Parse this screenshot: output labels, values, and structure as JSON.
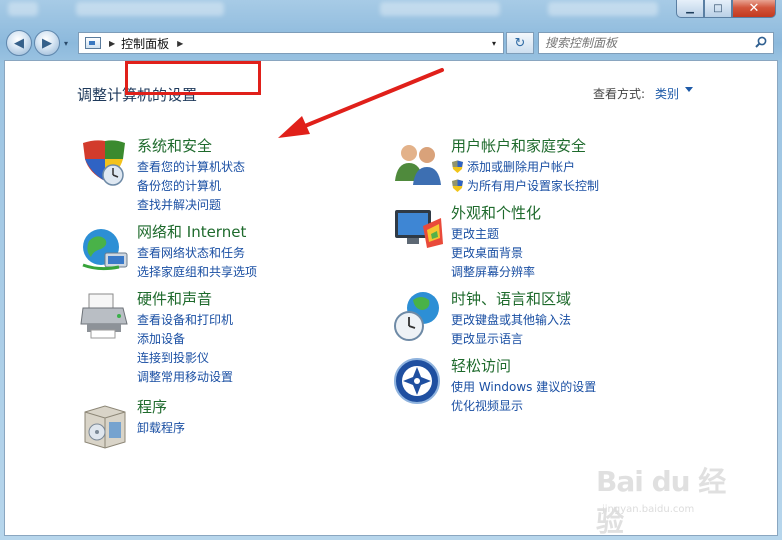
{
  "window": {
    "minimize_glyph": "▁",
    "maximize_glyph": "□",
    "close_glyph": "✕"
  },
  "navbar": {
    "back_glyph": "◀",
    "forward_glyph": "▶",
    "recent_glyph": "▾",
    "breadcrumb": "控制面板",
    "address_dropdown_glyph": "▾",
    "refresh_glyph": "↻",
    "search_placeholder": "搜索控制面板"
  },
  "header": {
    "title": "调整计算机的设置",
    "view_by_label": "查看方式:",
    "view_by_value": "类别"
  },
  "categories": [
    {
      "title": "系统和安全",
      "links": [
        "查看您的计算机状态",
        "备份您的计算机",
        "查找并解决问题"
      ]
    },
    {
      "title": "网络和 Internet",
      "links": [
        "查看网络状态和任务",
        "选择家庭组和共享选项"
      ]
    },
    {
      "title": "硬件和声音",
      "links": [
        "查看设备和打印机",
        "添加设备",
        "连接到投影仪",
        "调整常用移动设置"
      ]
    },
    {
      "title": "程序",
      "links": [
        "卸载程序"
      ]
    },
    {
      "title": "用户帐户和家庭安全",
      "links": [
        "添加或删除用户帐户",
        "为所有用户设置家长控制"
      ]
    },
    {
      "title": "外观和个性化",
      "links": [
        "更改主题",
        "更改桌面背景",
        "调整屏幕分辨率"
      ]
    },
    {
      "title": "时钟、语言和区域",
      "links": [
        "更改键盘或其他输入法",
        "更改显示语言"
      ]
    },
    {
      "title": "轻松访问",
      "links": [
        "使用 Windows 建议的设置",
        "优化视频显示"
      ]
    }
  ],
  "watermark": {
    "brand": "Bai du 经验",
    "url": "jingyan.baidu.com"
  },
  "colors": {
    "category_title": "#1e6a2c",
    "link": "#1a4fa3",
    "highlight": "#e0201a"
  }
}
